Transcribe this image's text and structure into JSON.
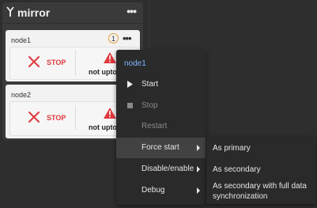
{
  "panel": {
    "title": "mirror",
    "menu_glyph": "•••",
    "icon": "fork-icon"
  },
  "nodes": [
    {
      "name": "node1",
      "badge": "1",
      "menu_glyph": "•••",
      "status": "STOP",
      "warning": "not uptodate"
    },
    {
      "name": "node2",
      "menu_glyph": "•••",
      "status": "STOP",
      "warning": "not uptodate"
    }
  ],
  "context_menu": {
    "title": "node1",
    "items": [
      {
        "label": "Start",
        "icon": "play-icon",
        "disabled": false
      },
      {
        "label": "Stop",
        "icon": "stop-square-icon",
        "disabled": true
      },
      {
        "label": "Restart",
        "icon": "",
        "disabled": true
      },
      {
        "label": "Force start",
        "icon": "",
        "submenu": true,
        "active": true
      },
      {
        "label": "Disable/enable",
        "icon": "",
        "submenu": true
      },
      {
        "label": "Debug",
        "icon": "",
        "submenu": true
      }
    ]
  },
  "submenu": {
    "items": [
      {
        "label": "As primary"
      },
      {
        "label": "As secondary"
      },
      {
        "label": "As secondary with full data synchronization"
      }
    ]
  },
  "colors": {
    "background": "#2e2e2e",
    "panel": "#3a3a3a",
    "card": "#f2f2f2",
    "stop_red": "#e0383d",
    "menu_bg": "#2a2a2a",
    "menu_title": "#7db4ff",
    "badge_ring": "#e0a030"
  }
}
